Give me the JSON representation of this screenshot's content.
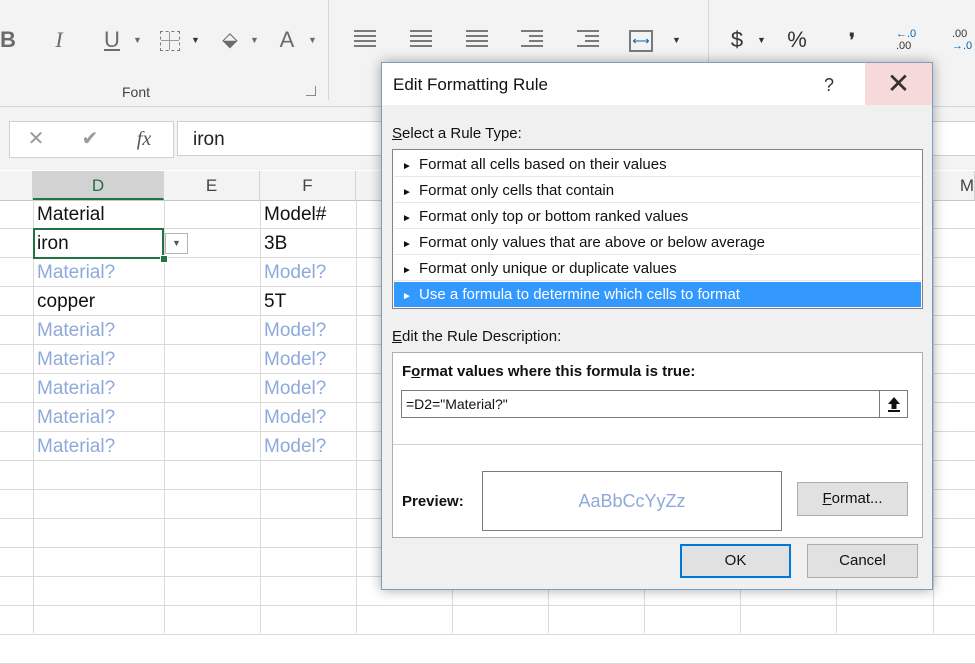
{
  "ribbon": {
    "font_group_label": "Font",
    "bold_glyph": "B",
    "italic_glyph": "I",
    "underline_glyph": "U",
    "font_color_glyph": "A",
    "currency_glyph": "$",
    "percent_glyph": "%",
    "comma_glyph": "❜",
    "increase_decimal": [
      ".00",
      "→.0"
    ],
    "decrease_decimal": [
      "←.0",
      ".00"
    ]
  },
  "formula_bar": {
    "cancel_glyph": "✕",
    "enter_glyph": "✔",
    "fx_glyph": "fx",
    "value": "iron"
  },
  "sheet": {
    "columns": [
      "D",
      "E",
      "F",
      "",
      "",
      "",
      "",
      "",
      "",
      "M"
    ],
    "rows": [
      {
        "d": "Material",
        "f": "Model#",
        "placeholder": false
      },
      {
        "d": "iron",
        "f": "3B",
        "placeholder": false
      },
      {
        "d": "Material?",
        "f": "Model?",
        "placeholder": true
      },
      {
        "d": "copper",
        "f": "5T",
        "placeholder": false
      },
      {
        "d": "Material?",
        "f": "Model?",
        "placeholder": true
      },
      {
        "d": "Material?",
        "f": "Model?",
        "placeholder": true
      },
      {
        "d": "Material?",
        "f": "Model?",
        "placeholder": true
      },
      {
        "d": "Material?",
        "f": "Model?",
        "placeholder": true
      },
      {
        "d": "Material?",
        "f": "Model?",
        "placeholder": true
      }
    ],
    "placeholder_color": "#8ea9db",
    "selection_color": "#217346"
  },
  "dialog": {
    "title": "Edit Formatting Rule",
    "help": "?",
    "close": "✕",
    "rule_type_label_underlined": "S",
    "rule_type_label_rest": "elect a Rule Type:",
    "rule_types": [
      "Format all cells based on their values",
      "Format only cells that contain",
      "Format only top or bottom ranked values",
      "Format only values that are above or below average",
      "Format only unique or duplicate values",
      "Use a formula to determine which cells to format"
    ],
    "selected_rule_index": 5,
    "rule_arrow": "►",
    "description_label_underlined": "E",
    "description_label_rest": "dit the Rule Description:",
    "formula_header_pre": "F",
    "formula_header_underlined": "o",
    "formula_header_rest": "rmat values where this formula is true:",
    "formula": "=D2=\"Material?\"",
    "collapse_glyph": "🡅",
    "preview_label": "Preview:",
    "preview_text": "AaBbCcYyZz",
    "format_button_underlined": "F",
    "format_button_rest": "ormat...",
    "ok_label": "OK",
    "cancel_label": "Cancel",
    "selection_color": "#3399ff"
  }
}
